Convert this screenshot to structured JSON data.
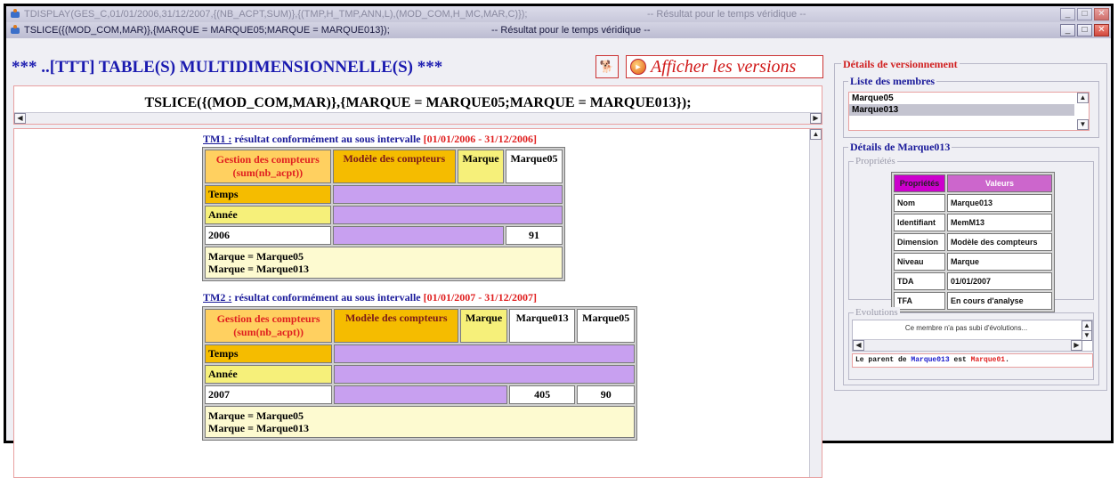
{
  "window1": {
    "title": "TDISPLAY(GES_C,01/01/2006,31/12/2007,{(NB_ACPT,SUM)},{(TMP,H_TMP,ANN,L),(MOD_COM,H_MC,MAR,C)});",
    "subtitle": "-- Résultat pour le temps véridique --"
  },
  "window2": {
    "title": "TSLICE({(MOD_COM,MAR)},{MARQUE = MARQUE05;MARQUE = MARQUE013});",
    "subtitle": "-- Résultat pour le temps véridique --"
  },
  "header": {
    "title": "*** ..[TTT] TABLE(S) MULTIDIMENSIONNELLE(S) ***",
    "afficher_label": "Afficher les versions"
  },
  "query": "TSLICE({(MOD_COM,MAR)},{MARQUE = MARQUE05;MARQUE = MARQUE013});",
  "tm1": {
    "link": "TM1 :",
    "desc": " résultat conformément au sous intervalle ",
    "interval": "[01/01/2006 - 31/12/2006]",
    "gestion": "Gestion des compteurs",
    "gestion_sub": "(sum(nb_acpt))",
    "modele": "Modèle des compteurs",
    "marque": "Marque",
    "cols": [
      "Marque05"
    ],
    "temps": "Temps",
    "annee": "Année",
    "year": "2006",
    "values": [
      "91"
    ],
    "foot1": "Marque = Marque05",
    "foot2": "Marque = Marque013"
  },
  "tm2": {
    "link": "TM2 :",
    "desc": " résultat conformément au sous intervalle ",
    "interval": "[01/01/2007 - 31/12/2007]",
    "gestion": "Gestion des compteurs",
    "gestion_sub": "(sum(nb_acpt))",
    "modele": "Modèle des compteurs",
    "marque": "Marque",
    "cols": [
      "Marque013",
      "Marque05"
    ],
    "temps": "Temps",
    "annee": "Année",
    "year": "2007",
    "values": [
      "405",
      "90"
    ],
    "foot1": "Marque = Marque05",
    "foot2": "Marque = Marque013"
  },
  "right": {
    "details_versionnement": "Détails de versionnement",
    "liste_membres": "Liste des membres",
    "members": [
      "Marque05",
      "Marque013"
    ],
    "selected_member": "Marque013",
    "details_member": "Détails de Marque013",
    "proprietes": "Propriétés",
    "props_header": [
      "Propriétés",
      "Valeurs"
    ],
    "props": [
      {
        "k": "Nom",
        "v": "Marque013"
      },
      {
        "k": "Identifiant",
        "v": "MemM13"
      },
      {
        "k": "Dimension",
        "v": "Modèle des compteurs"
      },
      {
        "k": "Niveau",
        "v": "Marque"
      },
      {
        "k": "TDA",
        "v": "01/01/2007"
      },
      {
        "k": "TFA",
        "v": "En cours d'analyse"
      }
    ],
    "evolutions": "Evolutions",
    "evolutions_text": "Ce membre n'a pas subi d'évolutions...",
    "parent_prefix": "Le parent de ",
    "parent_child": "Marque013",
    "parent_mid": " est ",
    "parent_parent": "Marque01",
    "parent_suffix": "."
  },
  "colors": {
    "link_blue": "#1a1a9a",
    "interval_red": "#e02020",
    "header_blue": "#1b1bb0",
    "violet": "#c8a0f0"
  }
}
